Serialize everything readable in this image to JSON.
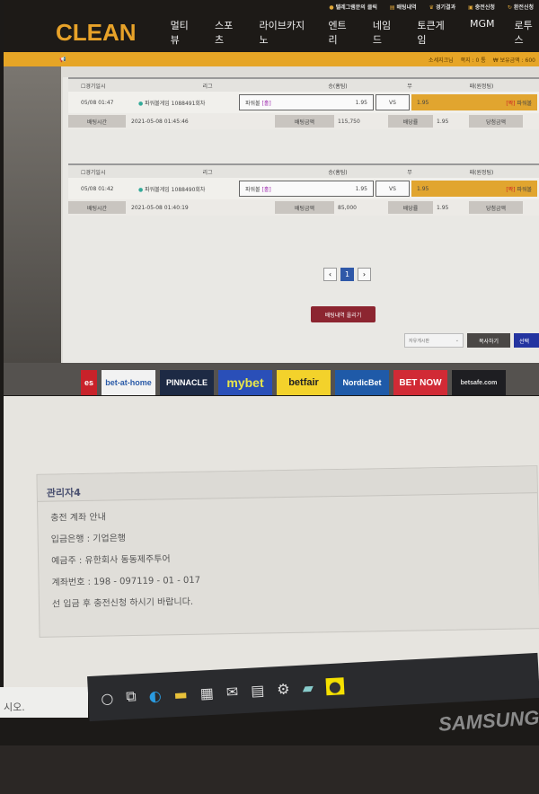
{
  "topbar": {
    "items": [
      "텔레그램문의 클릭",
      "배팅내역",
      "경기결과",
      "충전신청",
      "환전신청"
    ]
  },
  "header": {
    "logo": "CLEAN",
    "nav": [
      "멀티뷰",
      "스포츠",
      "라이브카지노",
      "엔트리",
      "네임드",
      "토큰게임",
      "MGM",
      "로투스"
    ]
  },
  "userbar": {
    "username": "소세지크님",
    "messages": "쪽지 : 0 통",
    "balance": "₩ 보유금액 : 600"
  },
  "table_headers": {
    "date": "경기일시",
    "league": "리그",
    "home": "승(홈팀)",
    "draw": "무",
    "away": "패(원정팀)"
  },
  "bets": [
    {
      "date": "05/08 01:47",
      "league": "파워볼게임 1088491회차",
      "home_label": "파워볼",
      "home_tag": "[홀]",
      "home_odds": "1.95",
      "vs": "VS",
      "away_odds": "1.95",
      "away_tag": "[짝]",
      "away_label": "파워볼",
      "bet_time_label": "배팅시간",
      "bet_time": "2021-05-08 01:45:46",
      "amount_label": "배팅금액",
      "amount": "115,750",
      "odds_label": "배당률",
      "odds": "1.95",
      "win_label": "당첨금액"
    },
    {
      "date": "05/08 01:42",
      "league": "파워볼게임 1088490회차",
      "home_label": "파워볼",
      "home_tag": "[홀]",
      "home_odds": "1.95",
      "vs": "VS",
      "away_odds": "1.95",
      "away_tag": "[짝]",
      "away_label": "파워볼",
      "bet_time_label": "배팅시간",
      "bet_time": "2021-05-08 01:40:19",
      "amount_label": "배팅금액",
      "amount": "85,000",
      "odds_label": "배당률",
      "odds": "1.95",
      "win_label": "당첨금액"
    }
  ],
  "pagination": {
    "prev": "‹",
    "current": "1",
    "next": "›"
  },
  "actions": {
    "upload": "배팅내역 올리기",
    "board_select": "자유게시판",
    "copy": "복사하기",
    "select": "선택"
  },
  "banners": [
    "es",
    "bet-at-home",
    "PINNACLE",
    "mybet",
    "betfair",
    "NordicBet",
    "BET NOW",
    "betsafe.com"
  ],
  "notice": {
    "author": "관리자4",
    "lines": [
      "충전 계좌 안내",
      "입금은행 : 기업은행",
      "예금주 : 유한회사 동동제주투어",
      "계좌번호 : 198 - 097119 - 01 - 017",
      "선 입금 후 충전신청 하시기 바랍니다."
    ]
  },
  "taskbar": {
    "search_tail": "시오."
  },
  "monitor": {
    "brand": "SAMSUNG"
  },
  "colors": {
    "brand": "#e7a229",
    "away_highlight": "#e1a52f",
    "upload_button": "#8c2530",
    "page_active": "#2f58a8"
  }
}
